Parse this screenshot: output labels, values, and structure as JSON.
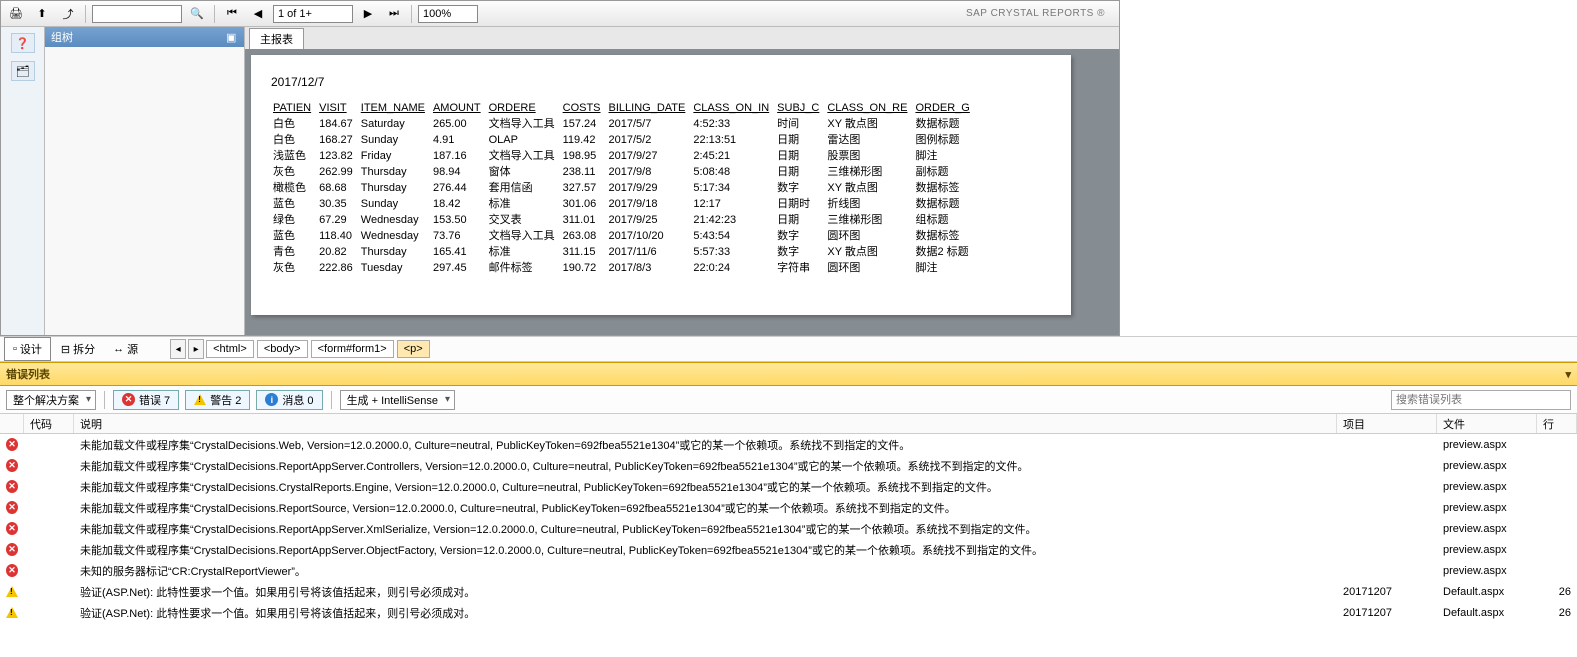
{
  "crystal": {
    "brand": "SAP CRYSTAL REPORTS ®",
    "page_label": "1 of 1+",
    "zoom": "100%",
    "search_value": "",
    "tree_title": "组树",
    "tab_label": "主报表",
    "report_date": "2017/12/7",
    "columns": [
      "PATIEN",
      "VISIT",
      "ITEM_NAME",
      "AMOUNT",
      "ORDERE",
      "COSTS",
      "BILLING_DATE",
      "CLASS_ON_IN",
      "SUBJ_C",
      "CLASS_ON_RE",
      "ORDER_G"
    ],
    "rows": [
      [
        "白色",
        "184.67",
        "Saturday",
        "265.00",
        "文档导入工具",
        "157.24",
        "2017/5/7",
        "4:52:33",
        "时间",
        "XY 散点图",
        "数据标题"
      ],
      [
        "白色",
        "168.27",
        "Sunday",
        "4.91",
        "OLAP",
        "119.42",
        "2017/5/2",
        "22:13:51",
        "日期",
        "雷达图",
        "图例标题"
      ],
      [
        "浅蓝色",
        "123.82",
        "Friday",
        "187.16",
        "文档导入工具",
        "198.95",
        "2017/9/27",
        "2:45:21",
        "日期",
        "股票图",
        "脚注"
      ],
      [
        "灰色",
        "262.99",
        "Thursday",
        "98.94",
        "窗体",
        "238.11",
        "2017/9/8",
        "5:08:48",
        "日期",
        "三维梯形图",
        "副标题"
      ],
      [
        "橄榄色",
        "68.68",
        "Thursday",
        "276.44",
        "套用信函",
        "327.57",
        "2017/9/29",
        "5:17:34",
        "数字",
        "XY 散点图",
        "数据标签"
      ],
      [
        "蓝色",
        "30.35",
        "Sunday",
        "18.42",
        "标准",
        "301.06",
        "2017/9/18",
        "12:17",
        "日期时",
        "折线图",
        "数据标题"
      ],
      [
        "绿色",
        "67.29",
        "Wednesday",
        "153.50",
        "交叉表",
        "311.01",
        "2017/9/25",
        "21:42:23",
        "日期",
        "三维梯形图",
        "组标题"
      ],
      [
        "蓝色",
        "118.40",
        "Wednesday",
        "73.76",
        "文档导入工具",
        "263.08",
        "2017/10/20",
        "5:43:54",
        "数字",
        "圆环图",
        "数据标签"
      ],
      [
        "青色",
        "20.82",
        "Thursday",
        "165.41",
        "标准",
        "311.15",
        "2017/11/6",
        "5:57:33",
        "数字",
        "XY 散点图",
        "数据2 标题"
      ],
      [
        "灰色",
        "222.86",
        "Tuesday",
        "297.45",
        "邮件标签",
        "190.72",
        "2017/8/3",
        "22:0:24",
        "字符串",
        "圆环图",
        "脚注"
      ]
    ]
  },
  "vs": {
    "tab_design": "设计",
    "tab_split": "拆分",
    "tab_source": "源",
    "crumbs": [
      "<html>",
      "<body>",
      "<form#form1>",
      "<p>"
    ]
  },
  "errlist": {
    "title": "错误列表",
    "scope": "整个解决方案",
    "errors_label": "错误 7",
    "warnings_label": "警告 2",
    "messages_label": "消息 0",
    "build_filter": "生成 + IntelliSense",
    "search_placeholder": "搜索错误列表",
    "col_code": "代码",
    "col_desc": "说明",
    "col_proj": "项目",
    "col_file": "文件",
    "col_line": "行",
    "rows": [
      {
        "type": "error",
        "desc": "未能加载文件或程序集“CrystalDecisions.Web, Version=12.0.2000.0, Culture=neutral, PublicKeyToken=692fbea5521e1304”或它的某一个依赖项。系统找不到指定的文件。",
        "proj": "",
        "file": "preview.aspx",
        "line": ""
      },
      {
        "type": "error",
        "desc": "未能加载文件或程序集“CrystalDecisions.ReportAppServer.Controllers, Version=12.0.2000.0, Culture=neutral, PublicKeyToken=692fbea5521e1304”或它的某一个依赖项。系统找不到指定的文件。",
        "proj": "",
        "file": "preview.aspx",
        "line": ""
      },
      {
        "type": "error",
        "desc": "未能加载文件或程序集“CrystalDecisions.CrystalReports.Engine, Version=12.0.2000.0, Culture=neutral, PublicKeyToken=692fbea5521e1304”或它的某一个依赖项。系统找不到指定的文件。",
        "proj": "",
        "file": "preview.aspx",
        "line": ""
      },
      {
        "type": "error",
        "desc": "未能加载文件或程序集“CrystalDecisions.ReportSource, Version=12.0.2000.0, Culture=neutral, PublicKeyToken=692fbea5521e1304”或它的某一个依赖项。系统找不到指定的文件。",
        "proj": "",
        "file": "preview.aspx",
        "line": ""
      },
      {
        "type": "error",
        "desc": "未能加载文件或程序集“CrystalDecisions.ReportAppServer.XmlSerialize, Version=12.0.2000.0, Culture=neutral, PublicKeyToken=692fbea5521e1304”或它的某一个依赖项。系统找不到指定的文件。",
        "proj": "",
        "file": "preview.aspx",
        "line": ""
      },
      {
        "type": "error",
        "desc": "未能加载文件或程序集“CrystalDecisions.ReportAppServer.ObjectFactory, Version=12.0.2000.0, Culture=neutral, PublicKeyToken=692fbea5521e1304”或它的某一个依赖项。系统找不到指定的文件。",
        "proj": "",
        "file": "preview.aspx",
        "line": ""
      },
      {
        "type": "error",
        "desc": "未知的服务器标记“CR:CrystalReportViewer”。",
        "proj": "",
        "file": "preview.aspx",
        "line": ""
      },
      {
        "type": "warn",
        "desc": "验证(ASP.Net): 此特性要求一个值。如果用引号将该值括起来，则引号必须成对。",
        "proj": "20171207",
        "file": "Default.aspx",
        "line": "26"
      },
      {
        "type": "warn",
        "desc": "验证(ASP.Net): 此特性要求一个值。如果用引号将该值括起来，则引号必须成对。",
        "proj": "20171207",
        "file": "Default.aspx",
        "line": "26"
      }
    ]
  }
}
